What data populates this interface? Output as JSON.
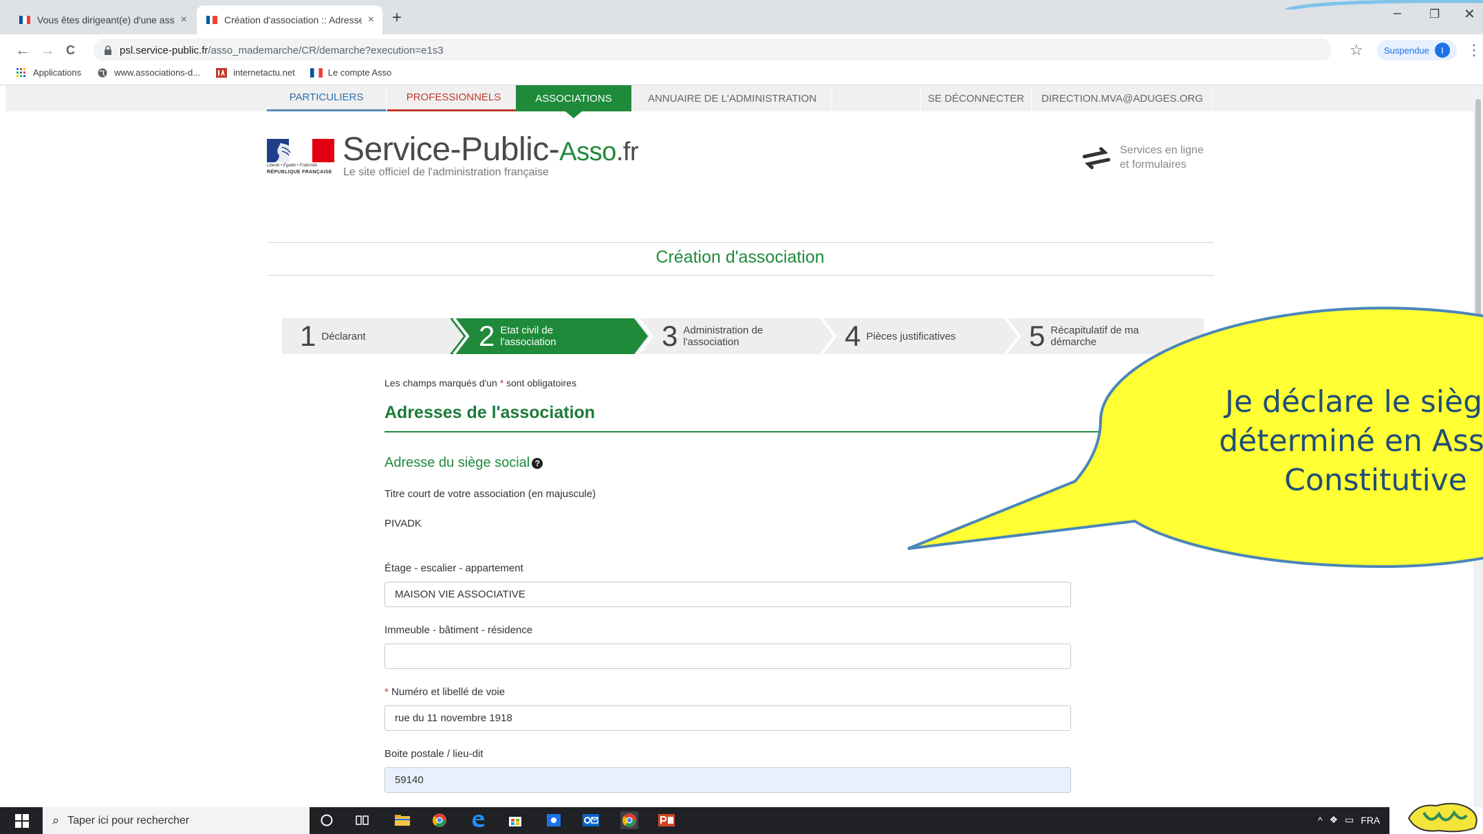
{
  "browser": {
    "tabs": [
      {
        "title": "Vous êtes dirigeant(e) d'une asso",
        "close": "×"
      },
      {
        "title": "Création d'association :: Adresse",
        "close": "×"
      }
    ],
    "new_tab": "+",
    "window_controls": {
      "minimize": "–",
      "restore": "❐",
      "close": "✕"
    },
    "nav": {
      "back": "←",
      "forward": "→",
      "reload": "C"
    },
    "url_host": "psl.service-public.fr",
    "url_path": "/asso_mademarche/CR/demarche?execution=e1s3",
    "bookmark_star": "☆",
    "profile_label": "Suspendue",
    "profile_initial": "I",
    "menu": "⋮",
    "bookmarks": [
      {
        "label": "Applications",
        "icon": "apps-grid-icon"
      },
      {
        "label": "www.associations-d...",
        "icon": "globe-icon"
      },
      {
        "label": "internetactu.net",
        "icon": "ia-icon"
      },
      {
        "label": "Le compte Asso",
        "icon": "flag-icon"
      }
    ]
  },
  "site": {
    "nav": {
      "particuliers": "PARTICULIERS",
      "professionnels": "PROFESSIONNELS",
      "associations": "ASSOCIATIONS",
      "annuaire": "ANNUAIRE DE L'ADMINISTRATION",
      "logout": "SE DÉCONNECTER",
      "account": "DIRECTION.MVA@ADUGES.ORG"
    },
    "logo": {
      "motto": "Liberté • Égalité • Fraternité",
      "republic": "RÉPUBLIQUE FRANÇAISE",
      "brand_main": "Service-Public-",
      "brand_asso": "Asso",
      "brand_tld": ".fr",
      "tagline": "Le site officiel de l'administration française"
    },
    "services": {
      "line1": "Services en ligne",
      "line2": "et formulaires"
    },
    "page_heading": "Création d'association"
  },
  "stepper": {
    "steps": [
      {
        "num": "1",
        "label_l1": "Déclarant",
        "label_l2": ""
      },
      {
        "num": "2",
        "label_l1": "Etat civil de",
        "label_l2": "l'association"
      },
      {
        "num": "3",
        "label_l1": "Administration de",
        "label_l2": "l'association"
      },
      {
        "num": "4",
        "label_l1": "Pièces justificatives",
        "label_l2": ""
      },
      {
        "num": "5",
        "label_l1": "Récapitulatif de ma",
        "label_l2": "démarche"
      }
    ],
    "current_step": 2,
    "colors": {
      "current": "#1f8a3a",
      "other": "#eeeeee"
    }
  },
  "form": {
    "required_prefix": "Les champs marqués d'un",
    "required_star": "*",
    "required_suffix": "sont obligatoires",
    "section_title": "Adresses de l'association",
    "subsection_title": "Adresse du siège social",
    "help_icon": "?",
    "short_title_label": "Titre court de votre association (en majuscule)",
    "short_title_value": "PIVADK",
    "floor_label": "Étage - escalier - appartement",
    "floor_value": "MAISON VIE ASSOCIATIVE",
    "building_label": "Immeuble - bâtiment - résidence",
    "building_value": "",
    "street_required": "*",
    "street_label": "Numéro et libellé de voie",
    "street_value": "rue du 11 novembre 1918",
    "pobox_label": "Boite postale / lieu-dit",
    "pobox_value": "59140"
  },
  "callout": {
    "line1": "Je déclare le siège s",
    "line2": "déterminé en Assem",
    "line3": "Constitutive",
    "fill": "#ffff33",
    "stroke": "#4a86b8"
  },
  "taskbar": {
    "search_placeholder": "Taper ici pour rechercher",
    "language": "FRA"
  },
  "colors": {
    "green": "#1f8a3a",
    "red": "#c0392b",
    "blue": "#2f6fa6"
  }
}
